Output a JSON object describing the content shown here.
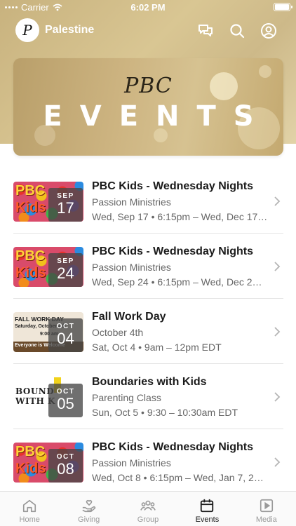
{
  "status_bar": {
    "carrier": "Carrier",
    "time": "6:02 PM"
  },
  "app": {
    "logo_letter": "P",
    "title": "Palestine"
  },
  "hero": {
    "script_text": "PBC",
    "title": "EVENTS"
  },
  "events": [
    {
      "title": "PBC Kids - Wednesday Nights",
      "subtitle": "Passion Ministries",
      "meta": "Wed, Sep 17 • 6:15pm – Wed, Dec 17…",
      "month": "SEP",
      "day": "17",
      "thumb": "kids",
      "thumb_text": [
        "PBC",
        "Kids"
      ]
    },
    {
      "title": "PBC Kids - Wednesday Nights",
      "subtitle": "Passion Ministries",
      "meta": "Wed, Sep 24 • 6:15pm – Wed, Dec 2…",
      "month": "SEP",
      "day": "24",
      "thumb": "kids",
      "thumb_text": [
        "PBC",
        "Kids"
      ]
    },
    {
      "title": "Fall Work Day",
      "subtitle": "October 4th",
      "meta": "Sat, Oct 4 • 9am – 12pm EDT",
      "month": "OCT",
      "day": "04",
      "thumb": "fall",
      "thumb_text": [
        "FALL WORK DAY",
        "Saturday, October 4th",
        "9:00 am",
        "Everyone is Welcome"
      ]
    },
    {
      "title": "Boundaries with Kids",
      "subtitle": "Parenting Class",
      "meta": "Sun, Oct 5 • 9:30 – 10:30am EDT",
      "month": "OCT",
      "day": "05",
      "thumb": "bound",
      "thumb_text": [
        "BOUND",
        "WITH K"
      ]
    },
    {
      "title": "PBC Kids - Wednesday Nights",
      "subtitle": "Passion Ministries",
      "meta": "Wed, Oct 8 • 6:15pm – Wed, Jan 7, 2…",
      "month": "OCT",
      "day": "08",
      "thumb": "kids",
      "thumb_text": [
        "PBC",
        "Kids"
      ]
    }
  ],
  "tabs": [
    {
      "label": "Home",
      "icon": "home-icon",
      "active": false
    },
    {
      "label": "Giving",
      "icon": "giving-icon",
      "active": false
    },
    {
      "label": "Group",
      "icon": "group-icon",
      "active": false
    },
    {
      "label": "Events",
      "icon": "events-icon",
      "active": true
    },
    {
      "label": "Media",
      "icon": "media-icon",
      "active": false
    }
  ],
  "colors": {
    "header_gold": "#d9c693",
    "active_tab": "#1b1b1b",
    "inactive_tab": "#9a9a9a"
  }
}
